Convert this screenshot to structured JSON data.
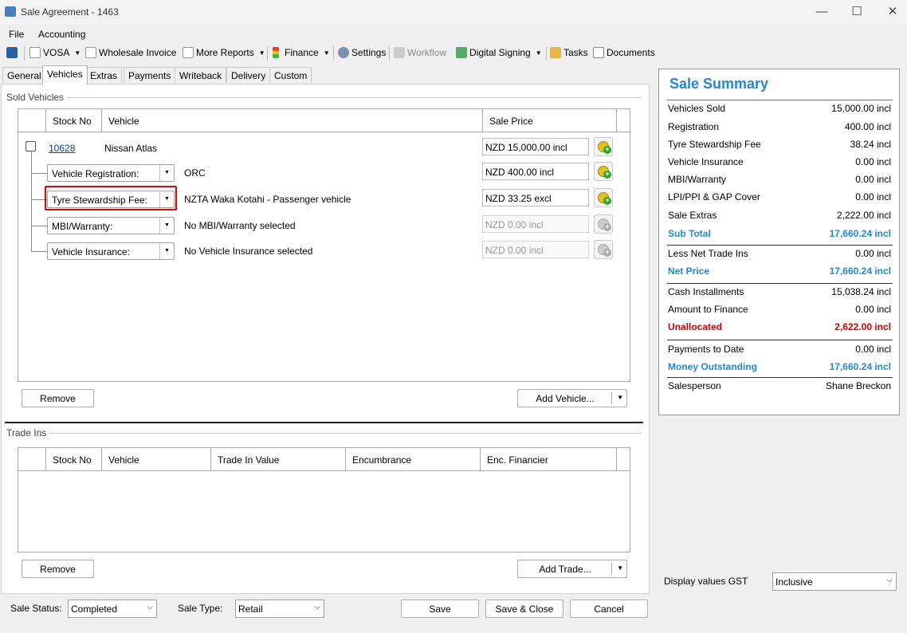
{
  "window": {
    "title": "Sale Agreement - 1463",
    "minimize": "—",
    "maximize": "☐",
    "close": "✕"
  },
  "menu": {
    "file": "File",
    "accounting": "Accounting"
  },
  "toolbar": {
    "vosa": "VOSA",
    "wholesale_invoice": "Wholesale Invoice",
    "more_reports": "More Reports",
    "finance": "Finance",
    "settings": "Settings",
    "workflow": "Workflow",
    "digital_signing": "Digital Signing",
    "tasks": "Tasks",
    "documents": "Documents"
  },
  "tabs": [
    "General",
    "Vehicles",
    "Extras",
    "Payments",
    "Writeback",
    "Delivery",
    "Custom"
  ],
  "sold_vehicles": {
    "group_label": "Sold Vehicles",
    "columns": {
      "stock_no": "Stock No",
      "vehicle": "Vehicle",
      "sale_price": "Sale Price"
    },
    "vehicle_row": {
      "stock_no": "10628",
      "vehicle": "Nissan Atlas",
      "price": "NZD 15,000.00 incl"
    },
    "sub_rows": [
      {
        "combo": "Vehicle Registration:",
        "description": "ORC",
        "price": "NZD 400.00 incl",
        "enabled": true
      },
      {
        "combo": "Tyre Stewardship Fee:",
        "description": "NZTA Waka Kotahi - Passenger vehicle",
        "price": "NZD 33.25 excl",
        "enabled": true
      },
      {
        "combo": "MBI/Warranty:",
        "description": "No MBI/Warranty selected",
        "price": "NZD 0.00 incl",
        "enabled": false
      },
      {
        "combo": "Vehicle Insurance:",
        "description": "No Vehicle Insurance selected",
        "price": "NZD 0.00 incl",
        "enabled": false
      }
    ],
    "remove_label": "Remove",
    "add_label": "Add Vehicle..."
  },
  "trade_ins": {
    "group_label": "Trade Ins",
    "columns": {
      "stock_no": "Stock No",
      "vehicle": "Vehicle",
      "trade_in_value": "Trade In Value",
      "encumbrance": "Encumbrance",
      "enc_financier": "Enc. Financier"
    },
    "remove_label": "Remove",
    "add_label": "Add Trade..."
  },
  "summary": {
    "title": "Sale Summary",
    "rows": [
      {
        "label": "Vehicles Sold",
        "value": "15,000.00 incl"
      },
      {
        "label": "Registration",
        "value": "400.00 incl"
      },
      {
        "label": "Tyre Stewardship Fee",
        "value": "38.24 incl"
      },
      {
        "label": "Vehicle Insurance",
        "value": "0.00 incl"
      },
      {
        "label": "MBI/Warranty",
        "value": "0.00 incl"
      },
      {
        "label": "LPI/PPI & GAP Cover",
        "value": "0.00 incl"
      },
      {
        "label": "Sale Extras",
        "value": "2,222.00 incl"
      },
      {
        "label": "Sub Total",
        "value": "17,660.24 incl"
      },
      {
        "label": "Less Net Trade Ins",
        "value": "0.00 incl"
      },
      {
        "label": "Net Price",
        "value": "17,660.24 incl"
      },
      {
        "label": "Cash Installments",
        "value": "15,038.24 incl"
      },
      {
        "label": "Amount to Finance",
        "value": "0.00 incl"
      },
      {
        "label": "Unallocated",
        "value": "2,622.00 incl"
      },
      {
        "label": "Payments to Date",
        "value": "0.00 incl"
      },
      {
        "label": "Money Outstanding",
        "value": "17,660.24 incl"
      },
      {
        "label": "Salesperson",
        "value": "Shane Breckon"
      }
    ]
  },
  "gst": {
    "label": "Display values GST",
    "value": "Inclusive"
  },
  "footer": {
    "sale_status_label": "Sale Status:",
    "sale_status_value": "Completed",
    "sale_type_label": "Sale Type:",
    "sale_type_value": "Retail",
    "save": "Save",
    "save_close": "Save & Close",
    "cancel": "Cancel"
  },
  "colors": {
    "accent": "#1e88e5",
    "alert": "#d50000",
    "highlight_border": "#e00000"
  },
  "icons": [
    "app-icon",
    "save-icon",
    "report-icon",
    "traffic-light-icon",
    "gear-icon",
    "workflow-icon",
    "signing-icon",
    "tasks-icon",
    "documents-icon",
    "add-icon"
  ]
}
